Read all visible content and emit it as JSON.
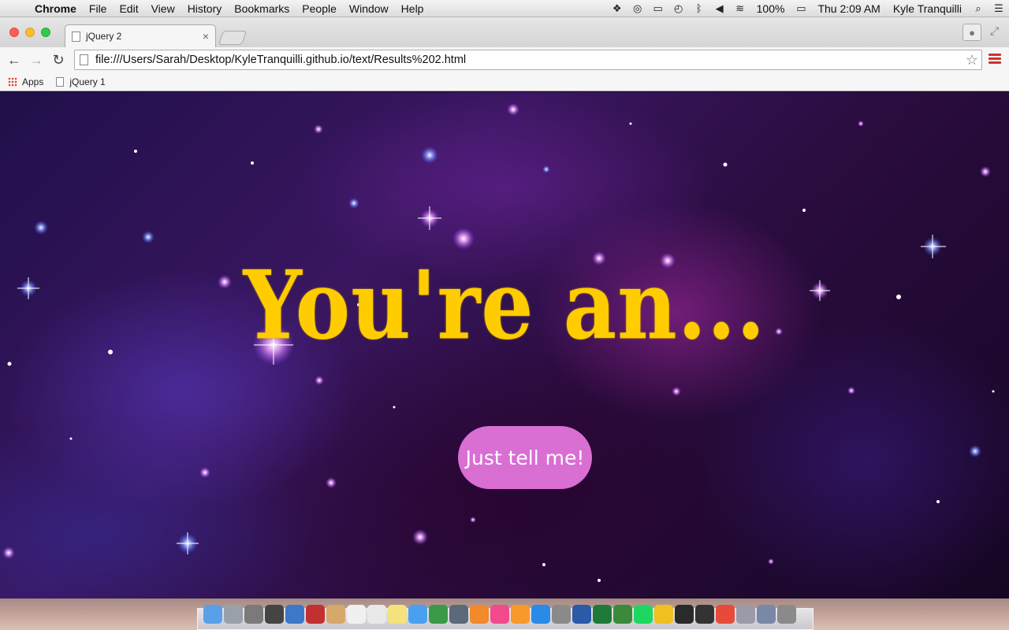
{
  "menubar": {
    "app_name": "Chrome",
    "items": [
      "File",
      "Edit",
      "View",
      "History",
      "Bookmarks",
      "People",
      "Window",
      "Help"
    ],
    "battery": "100%",
    "clock": "Thu 2:09 AM",
    "user": "Kyle Tranquilli"
  },
  "browser": {
    "tab_title": "jQuery 2",
    "url": "file:///Users/Sarah/Desktop/KyleTranquilli.github.io/text/Results%202.html",
    "bookmarks": {
      "apps_label": "Apps",
      "item_1": "jQuery 1"
    }
  },
  "page": {
    "headline": "You're an...",
    "button_label": "Just tell me!",
    "headline_color": "#ffcc00",
    "button_color": "#d96ed3"
  },
  "dock": {
    "icons": [
      "finder-icon",
      "launchpad-icon",
      "help-icon",
      "photo-booth-icon",
      "preview-icon",
      "photo-icon",
      "folder-icon",
      "calendar-icon",
      "notes-icon",
      "stickies-icon",
      "messages-icon",
      "facetime-icon",
      "image-capture-icon",
      "pages-icon",
      "itunes-icon",
      "ibooks-icon",
      "app-store-icon",
      "system-preferences-icon",
      "word-icon",
      "excel-icon",
      "dictionary-icon",
      "spotify-icon",
      "outlook-icon",
      "terminal-icon",
      "github-icon",
      "chrome-icon",
      "documents-icon",
      "downloads-icon",
      "trash-icon"
    ]
  }
}
